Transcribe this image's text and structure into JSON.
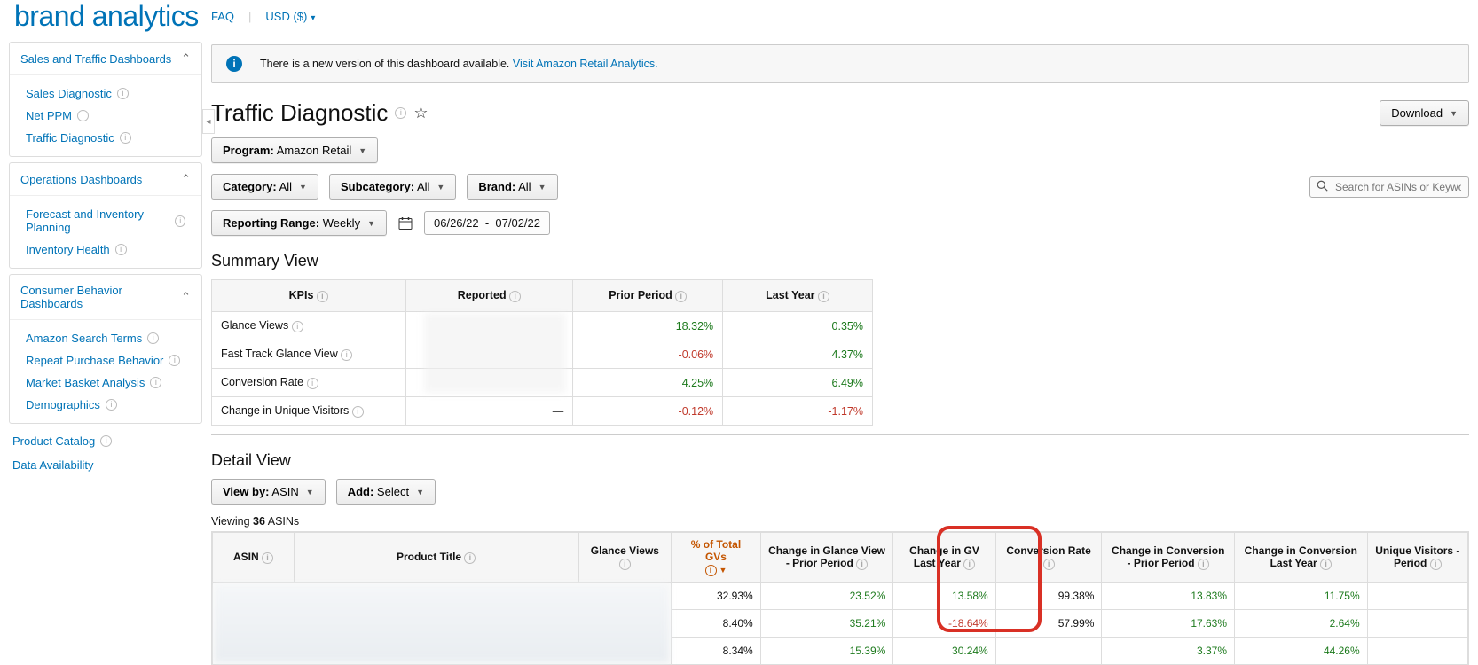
{
  "brand": "brand analytics",
  "top": {
    "faq": "FAQ",
    "currency": "USD ($)"
  },
  "sidebar": {
    "sections": [
      {
        "title": "Sales and Traffic Dashboards",
        "items": [
          "Sales Diagnostic",
          "Net PPM",
          "Traffic Diagnostic"
        ]
      },
      {
        "title": "Operations Dashboards",
        "items": [
          "Forecast and Inventory Planning",
          "Inventory Health"
        ]
      },
      {
        "title": "Consumer Behavior Dashboards",
        "items": [
          "Amazon Search Terms",
          "Repeat Purchase Behavior",
          "Market Basket Analysis",
          "Demographics"
        ]
      }
    ],
    "plain": [
      "Product Catalog",
      "Data Availability"
    ]
  },
  "banner": {
    "text": "There is a new version of this dashboard available.",
    "link": "Visit Amazon Retail Analytics."
  },
  "page": {
    "title": "Traffic Diagnostic",
    "download": "Download"
  },
  "filters": {
    "program_label": "Program:",
    "program_value": "Amazon Retail",
    "category_label": "Category:",
    "category_value": "All",
    "subcategory_label": "Subcategory:",
    "subcategory_value": "All",
    "brand_label": "Brand:",
    "brand_value": "All",
    "range_label": "Reporting Range:",
    "range_value": "Weekly",
    "date_from": "06/26/22",
    "date_to": "07/02/22",
    "search_placeholder": "Search for ASINs or Keywords"
  },
  "summary": {
    "heading": "Summary View",
    "headers": [
      "KPIs",
      "Reported",
      "Prior Period",
      "Last Year"
    ],
    "rows": [
      {
        "kpi": "Glance Views",
        "reported": "",
        "prior": "18.32%",
        "prior_sign": "pos",
        "last": "0.35%",
        "last_sign": "pos"
      },
      {
        "kpi": "Fast Track Glance View",
        "reported": "",
        "prior": "-0.06%",
        "prior_sign": "neg",
        "last": "4.37%",
        "last_sign": "pos"
      },
      {
        "kpi": "Conversion Rate",
        "reported": "",
        "prior": "4.25%",
        "prior_sign": "pos",
        "last": "6.49%",
        "last_sign": "pos"
      },
      {
        "kpi": "Change in Unique Visitors",
        "reported": "—",
        "prior": "-0.12%",
        "prior_sign": "neg",
        "last": "-1.17%",
        "last_sign": "neg"
      }
    ]
  },
  "detail": {
    "heading": "Detail View",
    "viewby_label": "View by:",
    "viewby_value": "ASIN",
    "add_label": "Add:",
    "add_value": "Select",
    "viewing_prefix": "Viewing",
    "viewing_count": "36",
    "viewing_suffix": "ASINs",
    "columns": [
      "ASIN",
      "Product Title",
      "Glance Views",
      "% of Total GVs",
      "Change in Glance View - Prior Period",
      "Change in GV Last Year",
      "Conversion Rate",
      "Change in Conversion - Prior Period",
      "Change in Conversion Last Year",
      "Unique Visitors - Period"
    ],
    "rows": [
      {
        "pct": "32.93%",
        "cgv_pp": "23.52%",
        "cgv_pp_sign": "pos",
        "cgv_ly": "13.58%",
        "cgv_ly_sign": "pos",
        "cr": "99.38%",
        "cc_pp": "13.83%",
        "cc_pp_sign": "pos",
        "cc_ly": "11.75%",
        "cc_ly_sign": "pos"
      },
      {
        "pct": "8.40%",
        "cgv_pp": "35.21%",
        "cgv_pp_sign": "pos",
        "cgv_ly": "-18.64%",
        "cgv_ly_sign": "neg",
        "cr": "57.99%",
        "cc_pp": "17.63%",
        "cc_pp_sign": "pos",
        "cc_ly": "2.64%",
        "cc_ly_sign": "pos"
      },
      {
        "pct": "8.34%",
        "cgv_pp": "15.39%",
        "cgv_pp_sign": "pos",
        "cgv_ly": "30.24%",
        "cgv_ly_sign": "pos",
        "cr": "",
        "cc_pp": "3.37%",
        "cc_pp_sign": "pos",
        "cc_ly": "44.26%",
        "cc_ly_sign": "pos"
      }
    ]
  }
}
